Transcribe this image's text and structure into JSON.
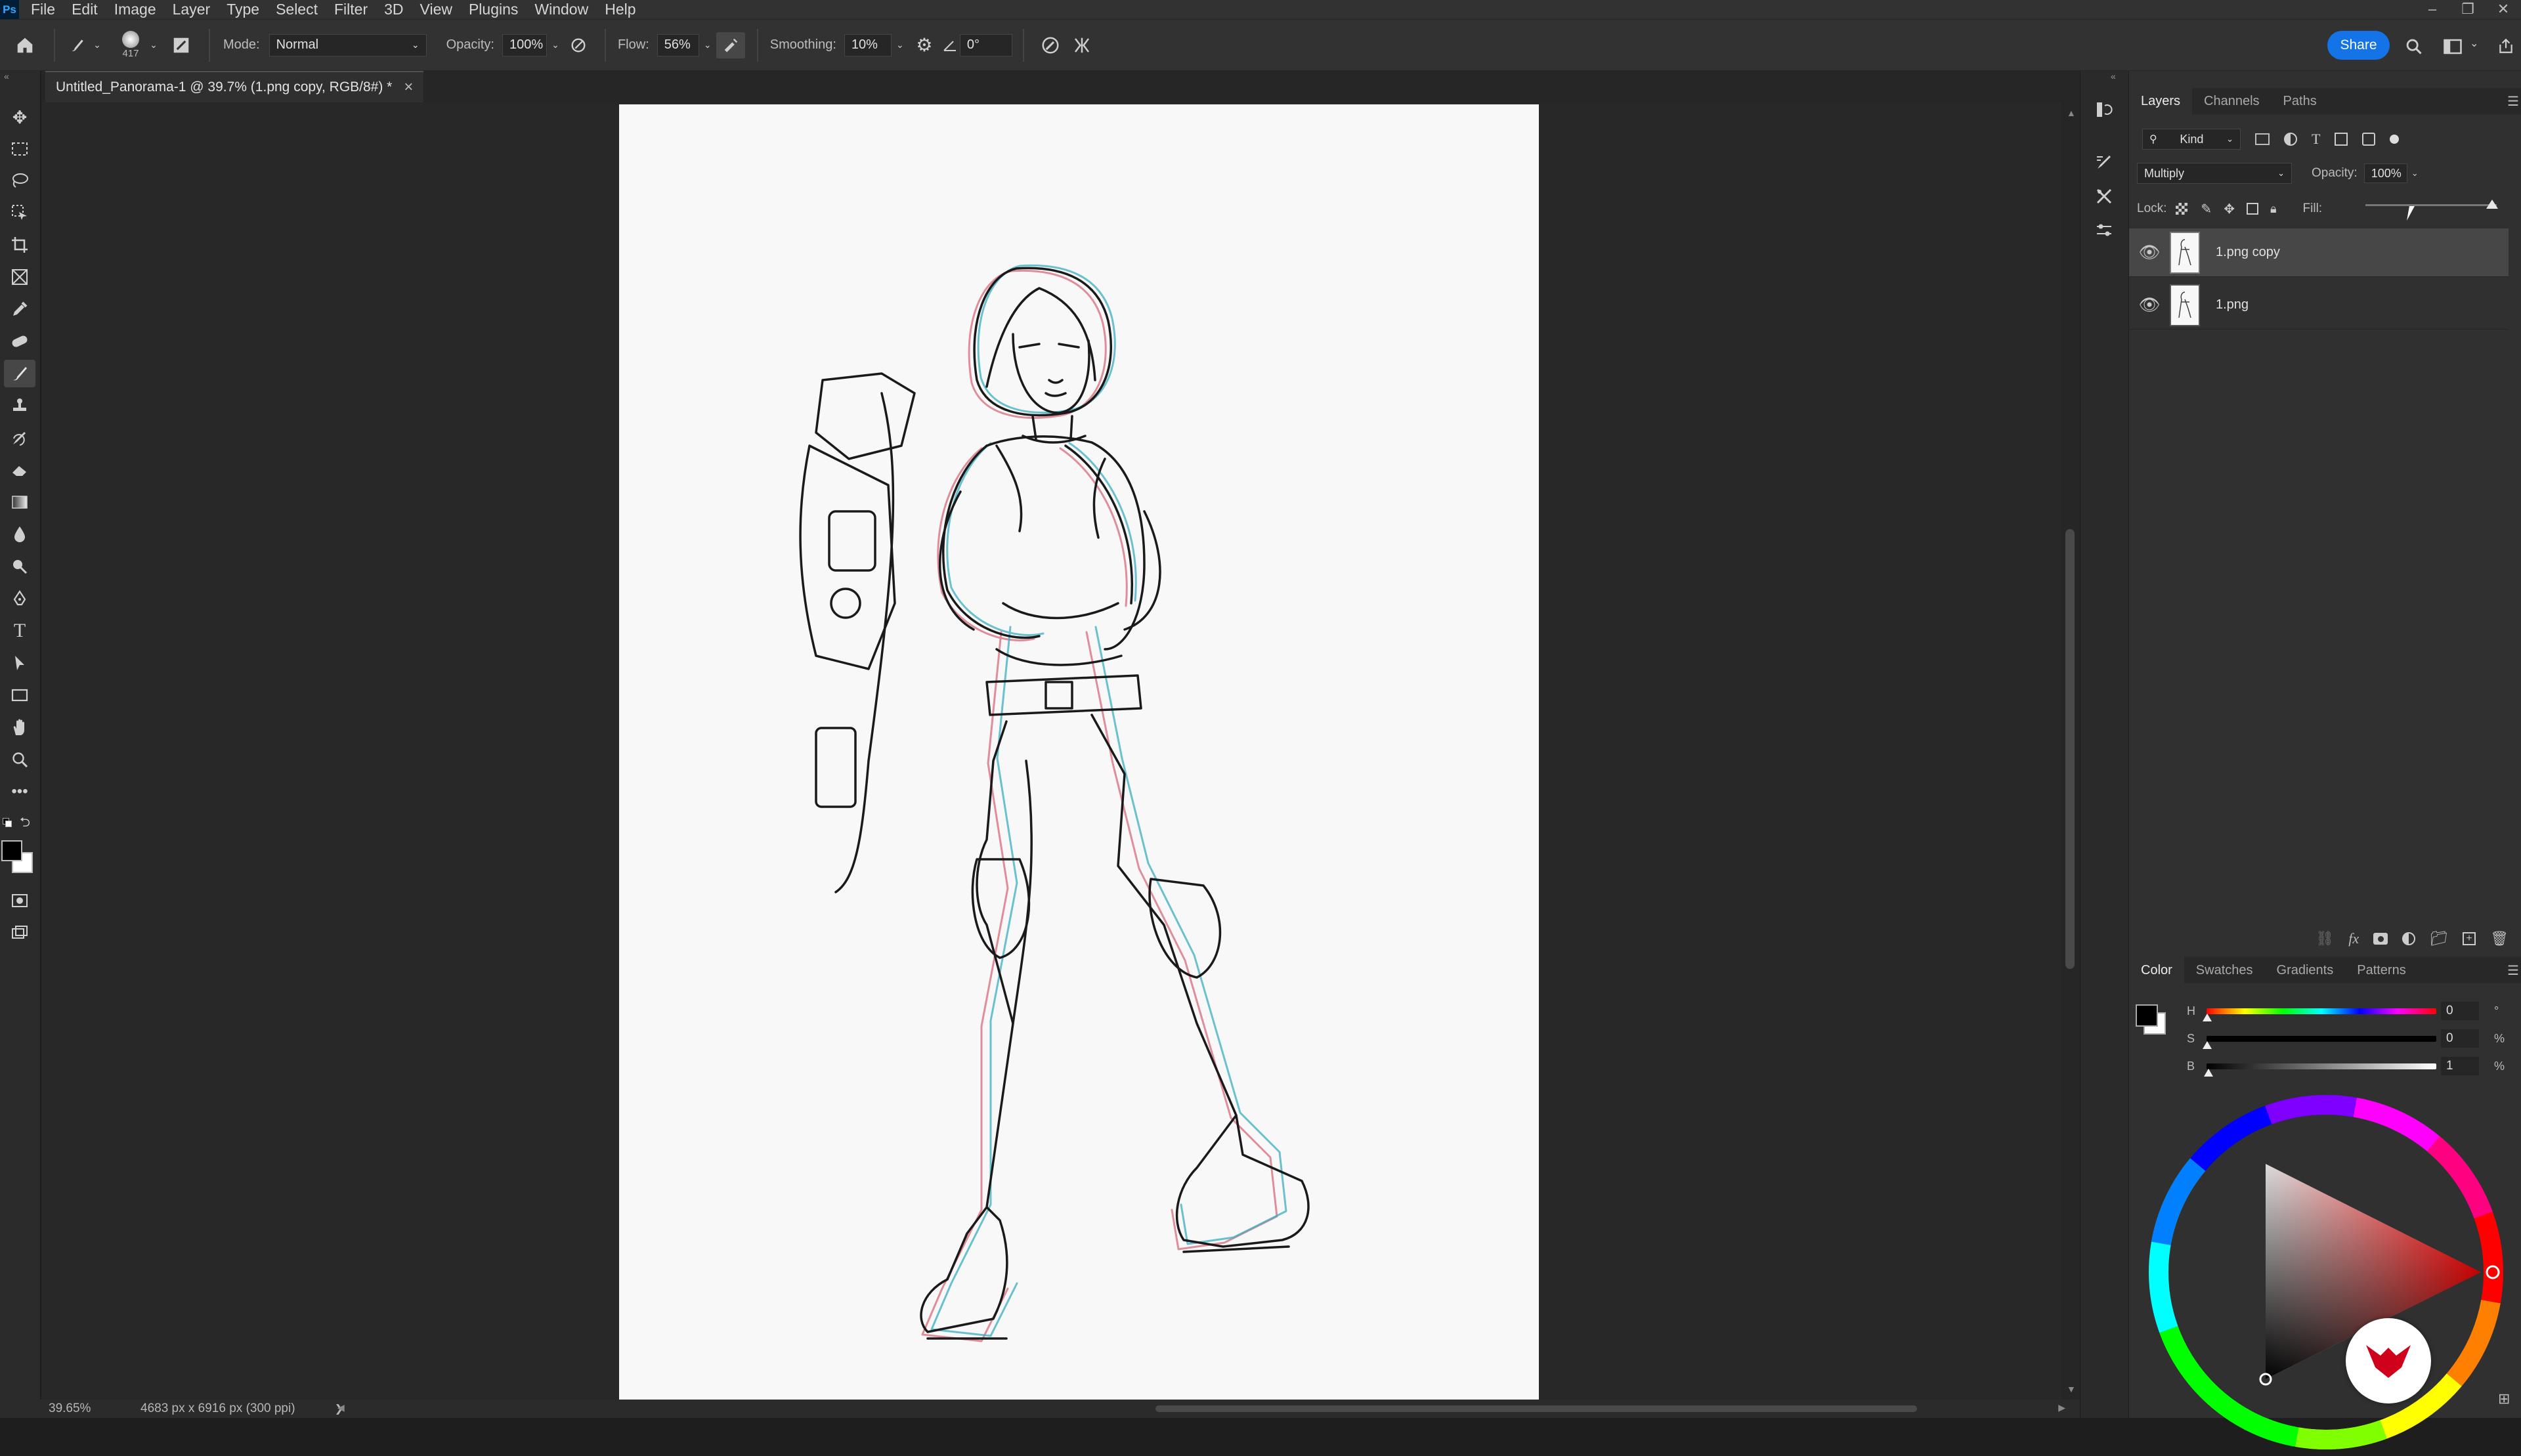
{
  "app": {
    "logo": "Ps"
  },
  "menu": [
    "File",
    "Edit",
    "Image",
    "Layer",
    "Type",
    "Select",
    "Filter",
    "3D",
    "View",
    "Plugins",
    "Window",
    "Help"
  ],
  "window_controls": [
    "–",
    "❐",
    "✕"
  ],
  "options": {
    "brush_size": "417",
    "mode_label": "Mode:",
    "mode_value": "Normal",
    "opacity_label": "Opacity:",
    "opacity_value": "100%",
    "flow_label": "Flow:",
    "flow_value": "56%",
    "smoothing_label": "Smoothing:",
    "smoothing_value": "10%",
    "angle_value": "0°",
    "share_label": "Share"
  },
  "document": {
    "tab_title": "Untitled_Panorama-1 @ 39.7% (1.png copy, RGB/8#) *",
    "close": "×"
  },
  "status": {
    "zoom": "39.65%",
    "info": "4683 px x 6916 px (300 ppi)",
    "arrow": "❯"
  },
  "layers_panel": {
    "tabs": [
      "Layers",
      "Channels",
      "Paths"
    ],
    "filter_label": "Kind",
    "blend_mode": "Multiply",
    "opacity_label": "Opacity:",
    "opacity_value": "100%",
    "lock_label": "Lock:",
    "fill_label": "Fill:",
    "layers": [
      {
        "name": "1.png copy",
        "selected": true
      },
      {
        "name": "1.png",
        "selected": false
      }
    ]
  },
  "color_panel": {
    "tabs": [
      "Color",
      "Swatches",
      "Gradients",
      "Patterns"
    ],
    "h_label": "H",
    "h_value": "0",
    "h_unit": "°",
    "s_label": "S",
    "s_value": "0",
    "s_unit": "%",
    "b_label": "B",
    "b_value": "1",
    "b_unit": "%",
    "foreground": "#000000",
    "background": "#ffffff"
  }
}
